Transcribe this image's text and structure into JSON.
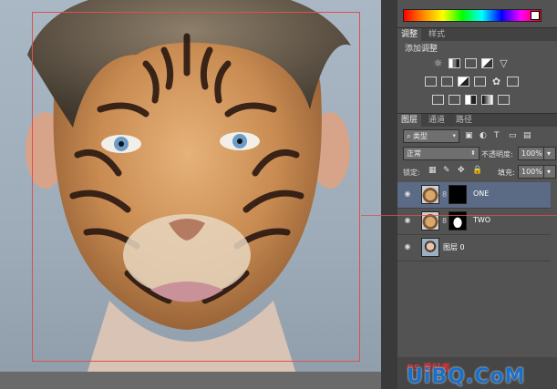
{
  "adjustments_panel": {
    "tabs": [
      {
        "label": "调整"
      },
      {
        "label": "样式"
      }
    ],
    "title": "添加调整",
    "icons_row1": [
      "brightness-icon",
      "levels-icon",
      "curves-icon",
      "exposure-icon",
      "vibrance-icon"
    ],
    "icons_row2": [
      "hue-saturation-icon",
      "color-balance-icon",
      "black-white-icon",
      "photo-filter-icon",
      "channel-mixer-icon",
      "color-lookup-icon"
    ],
    "icons_row3": [
      "invert-icon",
      "posterize-icon",
      "threshold-icon",
      "gradient-map-icon",
      "selective-color-icon"
    ]
  },
  "layers_panel": {
    "tabs": [
      {
        "label": "图层"
      },
      {
        "label": "通道"
      },
      {
        "label": "路径"
      }
    ],
    "filter_kind": "类型",
    "blend_mode": "正常",
    "opacity_label": "不透明度:",
    "opacity_value": "100%",
    "lock_label": "锁定:",
    "fill_label": "填充:",
    "fill_value": "100%",
    "layers": [
      {
        "name": "ONE",
        "selected": true
      },
      {
        "name": "TWO",
        "selected": false
      },
      {
        "name": "图层 0",
        "selected": false
      }
    ]
  },
  "colors": {
    "panel_bg": "#535353",
    "selected_layer": "#5b6a85",
    "selection_border": "#d9534f",
    "watermark_blue": "#1a6fc9"
  },
  "watermark": {
    "text": "UiBQ.CoM",
    "subtext": "PS 爱好者"
  }
}
